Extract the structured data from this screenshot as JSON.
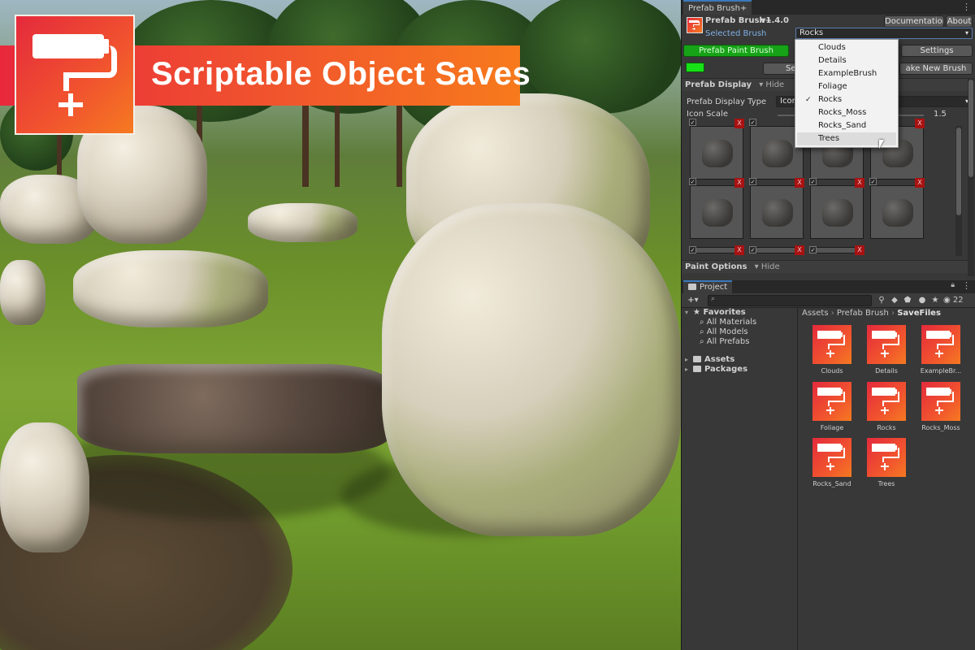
{
  "banner": {
    "title": "Scriptable Object Saves"
  },
  "colors": {
    "accent_red": "#e42a3c",
    "accent_orange": "#f57a21",
    "paint_green": "#17a317",
    "close_red": "#a81212"
  },
  "tool_window": {
    "tab": "Prefab Brush+",
    "app_name": "Prefab Brush+",
    "version": "v1.4.0",
    "documentation_label": "Documentation",
    "about_label": "About",
    "selected_brush_label": "Selected Brush",
    "selected_brush_value": "Rocks",
    "paint_button": "Prefab Paint Brush",
    "settings_button": "Settings",
    "select_button": "Sel",
    "make_new_brush_button": "ake New Brush",
    "prefab_display_section": "Prefab Display",
    "hide_label": "Hide",
    "display_type_label": "Prefab Display Type",
    "display_type_value": "Icon",
    "icon_scale_label": "Icon Scale",
    "icon_scale_value": "1.5",
    "paint_options_section": "Paint Options",
    "slot_remove": "X",
    "slot_check": "✓",
    "dropdown": {
      "options": [
        "Clouds",
        "Details",
        "ExampleBrush",
        "Foliage",
        "Rocks",
        "Rocks_Moss",
        "Rocks_Sand",
        "Trees"
      ],
      "selected": "Rocks",
      "hovered": "Trees"
    }
  },
  "project_window": {
    "tab": "Project",
    "add_label": "+",
    "hidden_count": "22",
    "favorites": {
      "label": "Favorites",
      "items": [
        "All Materials",
        "All Models",
        "All Prefabs"
      ]
    },
    "assets_label": "Assets",
    "packages_label": "Packages",
    "breadcrumb": [
      "Assets",
      "Prefab Brush",
      "SaveFiles"
    ],
    "files": [
      "Clouds",
      "Details",
      "ExampleBr...",
      "Foliage",
      "Rocks",
      "Rocks_Moss",
      "Rocks_Sand",
      "Trees"
    ]
  }
}
